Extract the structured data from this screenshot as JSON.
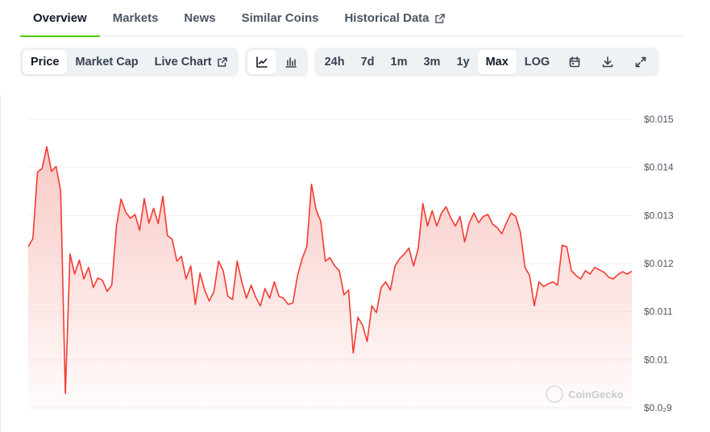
{
  "tabs": [
    {
      "label": "Overview",
      "active": true
    },
    {
      "label": "Markets"
    },
    {
      "label": "News"
    },
    {
      "label": "Similar Coins"
    },
    {
      "label": "Historical Data",
      "external": true
    }
  ],
  "toolbar": {
    "metric_buttons": [
      {
        "label": "Price",
        "active": true
      },
      {
        "label": "Market Cap"
      },
      {
        "label": "Live Chart",
        "external": true
      }
    ],
    "chart_style_icons": [
      {
        "icon": "line-chart-icon",
        "active": true
      },
      {
        "icon": "candlestick-chart-icon"
      }
    ],
    "ranges": [
      {
        "label": "24h"
      },
      {
        "label": "7d"
      },
      {
        "label": "1m"
      },
      {
        "label": "3m"
      },
      {
        "label": "1y"
      },
      {
        "label": "Max",
        "active": true
      },
      {
        "label": "LOG"
      }
    ],
    "action_icons": [
      "calendar-icon",
      "download-icon",
      "expand-icon"
    ]
  },
  "colors": {
    "line": "#f23a32",
    "fill_top": "#f8c6c2",
    "active_tab_underline": "#4bcc00"
  },
  "chart_data": {
    "type": "area",
    "yticks": [
      "$0.015",
      "$0.014",
      "$0.013",
      "$0.012",
      "$0.011",
      "$0.01",
      "$0.0₂9"
    ],
    "ylim": [
      0.009,
      0.015
    ],
    "grid": true,
    "watermark": "CoinGecko",
    "x": [
      0,
      1,
      2,
      3,
      4,
      5,
      6,
      7,
      8,
      9,
      10,
      11,
      12,
      13,
      14,
      15,
      16,
      17,
      18,
      19,
      20,
      21,
      22,
      23,
      24,
      25,
      26,
      27,
      28,
      29,
      30,
      31,
      32,
      33,
      34,
      35,
      36,
      37,
      38,
      39,
      40,
      41,
      42,
      43,
      44,
      45,
      46,
      47,
      48,
      49,
      50,
      51,
      52,
      53,
      54,
      55,
      56,
      57,
      58,
      59,
      60,
      61,
      62,
      63,
      64,
      65,
      66,
      67,
      68,
      69,
      70,
      71,
      72,
      73,
      74,
      75,
      76,
      77,
      78,
      79,
      80,
      81,
      82,
      83,
      84,
      85,
      86,
      87,
      88,
      89,
      90,
      91,
      92,
      93,
      94,
      95,
      96,
      97,
      98,
      99,
      100,
      101,
      102,
      103,
      104,
      105,
      106,
      107,
      108,
      109,
      110,
      111,
      112,
      113,
      114,
      115,
      116,
      117,
      118,
      119,
      120,
      121,
      122,
      123,
      124,
      125,
      126,
      127,
      128,
      129,
      130
    ],
    "values": [
      0.01235,
      0.01252,
      0.0139,
      0.01398,
      0.01443,
      0.01392,
      0.01402,
      0.01351,
      0.0093,
      0.0122,
      0.01178,
      0.01207,
      0.01168,
      0.01192,
      0.0115,
      0.0117,
      0.01165,
      0.01142,
      0.01155,
      0.01278,
      0.01334,
      0.01307,
      0.01294,
      0.01302,
      0.01269,
      0.01335,
      0.01284,
      0.01315,
      0.01283,
      0.0134,
      0.01258,
      0.01251,
      0.01205,
      0.01215,
      0.01168,
      0.01195,
      0.01115,
      0.0118,
      0.01145,
      0.01122,
      0.01142,
      0.01205,
      0.01185,
      0.01132,
      0.01125,
      0.01205,
      0.01162,
      0.01128,
      0.01155,
      0.0113,
      0.01112,
      0.01148,
      0.01128,
      0.01162,
      0.01132,
      0.01128,
      0.01115,
      0.01118,
      0.01175,
      0.0121,
      0.01235,
      0.01365,
      0.01312,
      0.01288,
      0.01205,
      0.01212,
      0.01195,
      0.01185,
      0.01135,
      0.01145,
      0.01014,
      0.01088,
      0.01072,
      0.01038,
      0.01112,
      0.01098,
      0.0115,
      0.01162,
      0.01145,
      0.01195,
      0.0121,
      0.0122,
      0.01232,
      0.01195,
      0.01232,
      0.01325,
      0.01278,
      0.0131,
      0.01278,
      0.01305,
      0.01318,
      0.01295,
      0.01278,
      0.01298,
      0.01245,
      0.01285,
      0.01305,
      0.01285,
      0.01298,
      0.01302,
      0.01282,
      0.01275,
      0.01262,
      0.01285,
      0.01305,
      0.01298,
      0.01265,
      0.01192,
      0.01175,
      0.01112,
      0.01162,
      0.01152,
      0.01158,
      0.01162,
      0.01155,
      0.01238,
      0.01235,
      0.01185,
      0.01175,
      0.01168,
      0.01185,
      0.01178,
      0.01192,
      0.01187,
      0.01182,
      0.01172,
      0.01168,
      0.01177,
      0.01183,
      0.01178,
      0.01184
    ]
  }
}
